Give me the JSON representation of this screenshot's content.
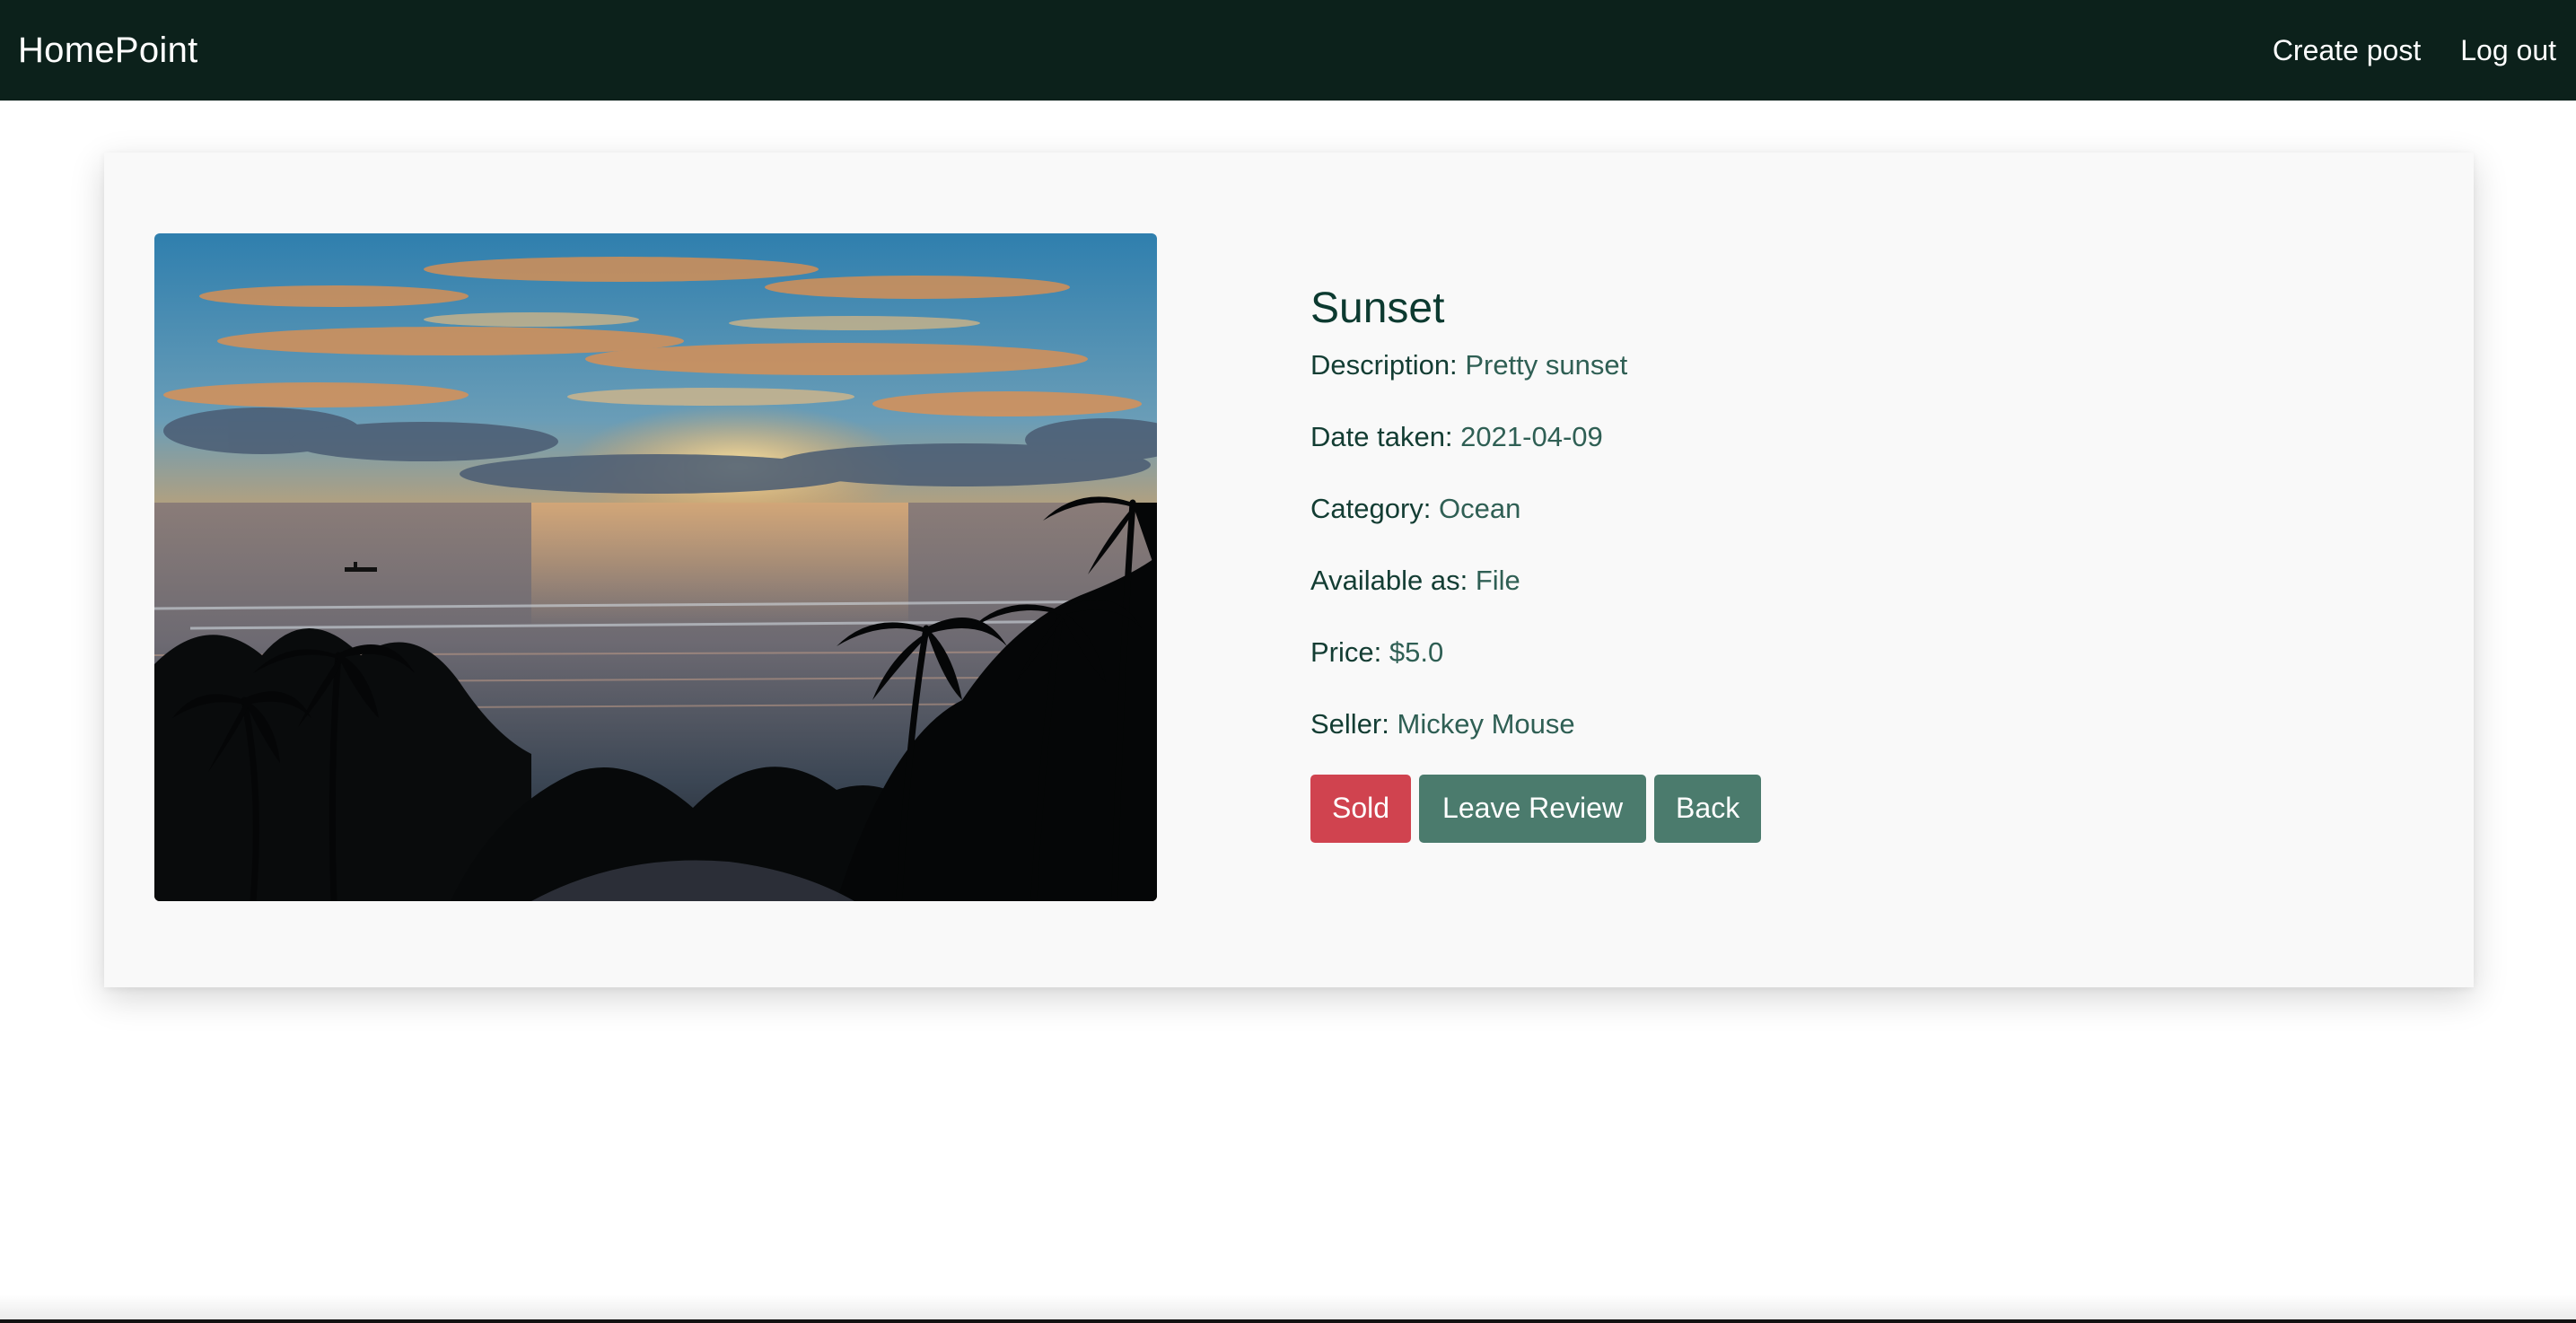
{
  "navbar": {
    "brand": "HomePoint",
    "links": [
      {
        "label": "Create post"
      },
      {
        "label": "Log out"
      }
    ],
    "background": "#0c211b"
  },
  "post": {
    "title": "Sunset",
    "fields": [
      {
        "label": "Description:",
        "value": "Pretty sunset"
      },
      {
        "label": "Date taken:",
        "value": "2021-04-09"
      },
      {
        "label": "Category:",
        "value": "Ocean"
      },
      {
        "label": "Available as:",
        "value": "File"
      },
      {
        "label": "Price:",
        "value": "$5.0"
      },
      {
        "label": "Seller:",
        "value": "Mickey Mouse"
      }
    ],
    "image_alt": "sunset-beach-photo"
  },
  "actions": {
    "sold_label": "Sold",
    "review_label": "Leave Review",
    "back_label": "Back"
  },
  "colors": {
    "sold": "#d0434f",
    "primary": "#4b7b6d",
    "text": "#0c3a30"
  }
}
